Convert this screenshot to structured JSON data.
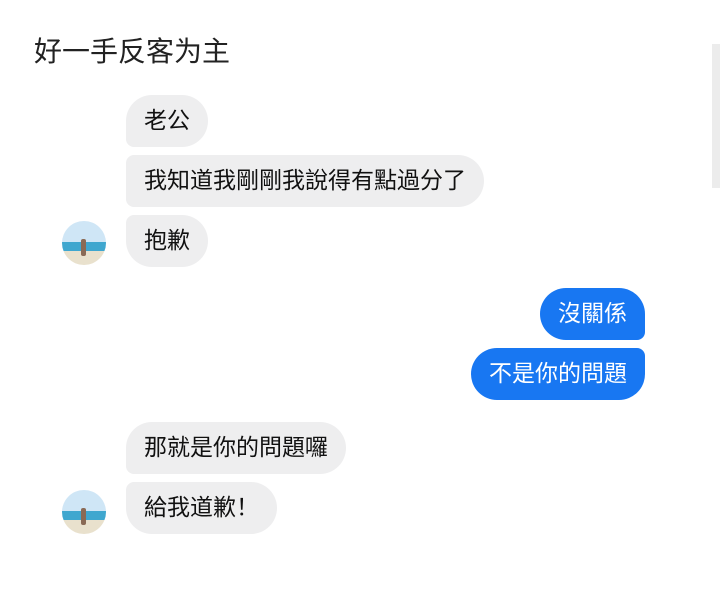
{
  "caption": "好一手反客为主",
  "chat": {
    "group1": [
      "老公",
      "我知道我剛剛我說得有點過分了",
      "抱歉"
    ],
    "group2": [
      "沒關係",
      "不是你的問題"
    ],
    "group3": [
      "那就是你的問題囉",
      "給我道歉！"
    ]
  },
  "colors": {
    "incoming_bubble": "#eeeeef",
    "outgoing_bubble": "#1877f2",
    "text_dark": "#111111",
    "text_light": "#ffffff"
  },
  "icons": {
    "avatar": "contact-avatar-beach-photo"
  }
}
